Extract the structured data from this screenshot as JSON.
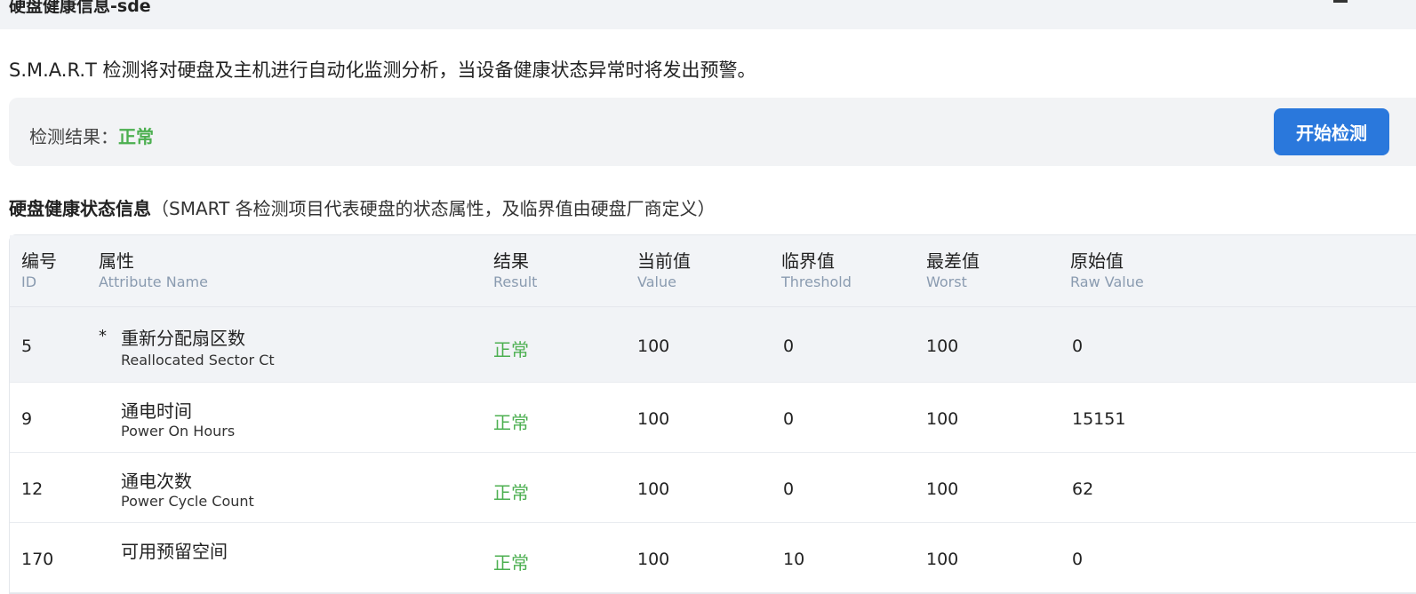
{
  "header": {
    "title": "硬盘健康信息-sde"
  },
  "intro": "S.M.A.R.T 检测将对硬盘及主机进行自动化监测分析，当设备健康状态异常时将发出预警。",
  "result": {
    "label": "检测结果：",
    "status": "正常",
    "button": "开始检测"
  },
  "section": {
    "title": "硬盘健康状态信息",
    "note": "（SMART 各检测项目代表硬盘的状态属性，及临界值由硬盘厂商定义）"
  },
  "table": {
    "columns": [
      {
        "zh": "编号",
        "en": "ID"
      },
      {
        "zh": "属性",
        "en": "Attribute Name"
      },
      {
        "zh": "结果",
        "en": "Result"
      },
      {
        "zh": "当前值",
        "en": "Value"
      },
      {
        "zh": "临界值",
        "en": "Threshold"
      },
      {
        "zh": "最差值",
        "en": "Worst"
      },
      {
        "zh": "原始值",
        "en": "Raw Value"
      }
    ],
    "rows": [
      {
        "id": "5",
        "star": "*",
        "zh": "重新分配扇区数",
        "en": "Reallocated Sector Ct",
        "result": "正常",
        "value": "100",
        "threshold": "0",
        "worst": "100",
        "raw": "0"
      },
      {
        "id": "9",
        "star": "",
        "zh": "通电时间",
        "en": "Power On Hours",
        "result": "正常",
        "value": "100",
        "threshold": "0",
        "worst": "100",
        "raw": "15151"
      },
      {
        "id": "12",
        "star": "",
        "zh": "通电次数",
        "en": "Power Cycle Count",
        "result": "正常",
        "value": "100",
        "threshold": "0",
        "worst": "100",
        "raw": "62"
      },
      {
        "id": "170",
        "star": "",
        "zh": "可用预留空间",
        "en": "",
        "result": "正常",
        "value": "100",
        "threshold": "10",
        "worst": "100",
        "raw": "0"
      }
    ]
  }
}
